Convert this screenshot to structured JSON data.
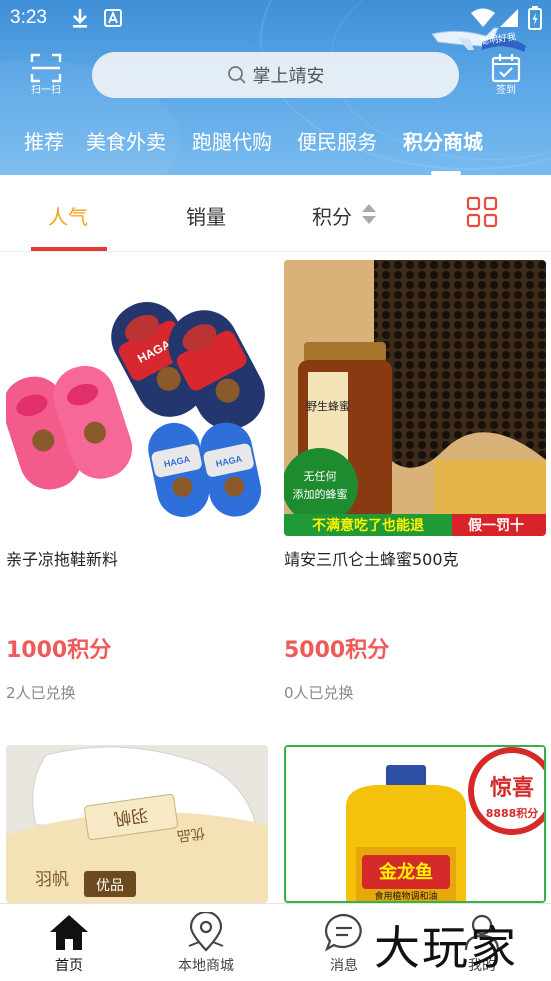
{
  "status_bar": {
    "time": "3:23",
    "icons": [
      "download-icon",
      "a-notification-icon",
      "wifi-icon",
      "signal-icon",
      "battery-icon"
    ]
  },
  "header": {
    "scan_label": "扫一扫",
    "search_placeholder": "掌上靖安",
    "badge_text": "聪明好我",
    "signin_label": "签到",
    "background_color": "#4f9ee2"
  },
  "category_tabs": [
    {
      "label": "推荐",
      "active": false
    },
    {
      "label": "美食外卖",
      "active": false
    },
    {
      "label": "跑腿代购",
      "active": false
    },
    {
      "label": "便民服务",
      "active": false
    },
    {
      "label": "积分商城",
      "active": true
    }
  ],
  "sort_bar": {
    "items": [
      {
        "label": "人气",
        "active": true
      },
      {
        "label": "销量",
        "active": false
      },
      {
        "label": "积分",
        "active": false
      }
    ],
    "active_color": "#f0a31a",
    "underline_color": "#e53935"
  },
  "products": [
    {
      "title": "亲子凉拖鞋新料",
      "points": "1000积分",
      "exchanged": "2人已兑换",
      "image_text": [
        "HAGA",
        "HAGA",
        "HAGA"
      ]
    },
    {
      "title": "靖安三爪仑土蜂蜜500克",
      "points": "5000积分",
      "exchanged": "0人已兑换",
      "image_text": [
        "野生蜂蜜",
        "无任何",
        "添加的蜂蜜",
        "不满意吃了也能退",
        "假一罚十"
      ]
    },
    {
      "title": "",
      "points": "",
      "exchanged": "",
      "image_text": [
        "羽帆",
        "优品",
        "优品"
      ]
    },
    {
      "title": "",
      "points": "",
      "exchanged": "",
      "image_text": [
        "惊喜",
        "8888积分",
        "金龙鱼",
        "食用植物调和油"
      ]
    }
  ],
  "bottom_nav": [
    {
      "label": "首页",
      "icon": "home-icon",
      "active": true
    },
    {
      "label": "本地商城",
      "icon": "location-icon",
      "active": false
    },
    {
      "label": "消息",
      "icon": "message-icon",
      "active": false
    },
    {
      "label": "我的",
      "icon": "user-icon",
      "active": false
    }
  ],
  "watermark": "大玩家",
  "colors": {
    "points": "#ef5a5a",
    "header_top": "#3f8fd6",
    "header_bottom": "#78bbef"
  }
}
